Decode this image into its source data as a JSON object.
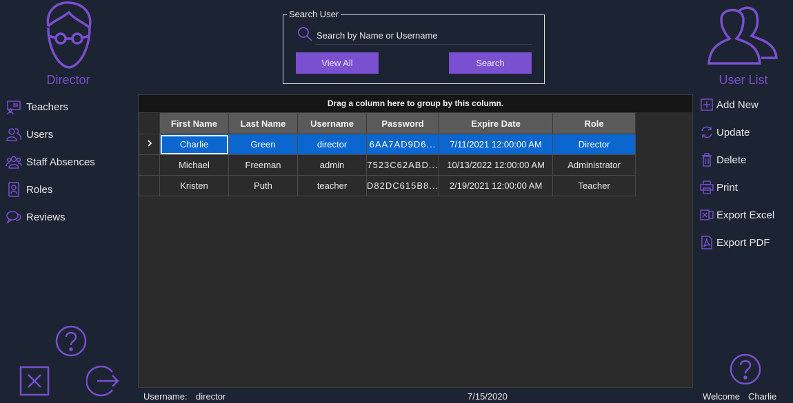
{
  "left_panel": {
    "role_title": "Director",
    "nav": [
      {
        "label": "Teachers",
        "icon": "teacher-board-icon"
      },
      {
        "label": "Users",
        "icon": "users-icon"
      },
      {
        "label": "Staff Absences",
        "icon": "staff-group-icon"
      },
      {
        "label": "Roles",
        "icon": "badge-icon"
      },
      {
        "label": "Reviews",
        "icon": "chat-bubbles-icon"
      }
    ]
  },
  "search": {
    "legend": "Search User",
    "placeholder": "Search by Name or Username",
    "view_all_label": "View All",
    "search_label": "Search"
  },
  "grid": {
    "group_panel_text": "Drag a column here to group by this column.",
    "columns": [
      "First Name",
      "Last Name",
      "Username",
      "Password",
      "Expire Date",
      "Role"
    ],
    "rows": [
      [
        "Charlie",
        "Green",
        "director",
        "6AA7AD9D6...",
        "7/11/2021 12:00:00 AM",
        "Director"
      ],
      [
        "Michael",
        "Freeman",
        "admin",
        "7523C62ABD...",
        "10/13/2022 12:00:00 AM",
        "Administrator"
      ],
      [
        "Kristen",
        "Puth",
        "teacher",
        "D82DC615B8...",
        "2/19/2021 12:00:00 AM",
        "Teacher"
      ]
    ],
    "selected_row": 0
  },
  "right_panel": {
    "page_title": "User List",
    "actions": [
      {
        "label": "Add New",
        "icon": "add-icon"
      },
      {
        "label": "Update",
        "icon": "refresh-icon"
      },
      {
        "label": "Delete",
        "icon": "trash-icon"
      },
      {
        "label": "Print",
        "icon": "printer-icon"
      },
      {
        "label": "Export Excel",
        "icon": "excel-icon"
      },
      {
        "label": "Export PDF",
        "icon": "pdf-icon"
      }
    ]
  },
  "status": {
    "username_label": "Username:",
    "username_value": "director",
    "date": "7/15/2020",
    "welcome_label": "Welcome",
    "welcome_user": "Charlie"
  },
  "colors": {
    "background": "#1c2332",
    "accent": "#7a4fd0",
    "selection": "#0b67cf",
    "grid_background": "#2b2b2b"
  }
}
